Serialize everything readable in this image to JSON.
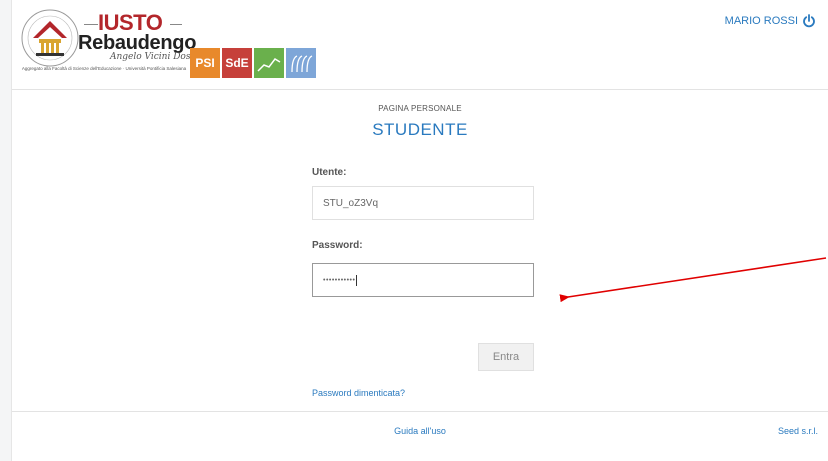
{
  "header": {
    "logo": {
      "brand_top": "IUSTO",
      "brand_name": "Rebaudengo",
      "signature": "Angelo Vicini Dosi",
      "aggregation": "Aggregato alla Facoltà di Scienze dell'Educazione · Università Pontificia Salesiana",
      "tiles": [
        {
          "label": "PSI",
          "color": "#e8892b"
        },
        {
          "label": "SdE",
          "color": "#c6403a"
        },
        {
          "label": "",
          "color": "#6ab04c"
        },
        {
          "label": "",
          "color": "#7ea6d8"
        }
      ]
    },
    "user": {
      "name": "MARIO ROSSI",
      "logout_icon": "power-icon"
    }
  },
  "main": {
    "subtitle": "PAGINA PERSONALE",
    "title": "STUDENTE",
    "username_label": "Utente:",
    "username_value": "STU_oZ3Vq",
    "password_label": "Password:",
    "password_value": "•••••••••••",
    "submit_label": "Entra",
    "forgot_label": "Password dimenticata?"
  },
  "footer": {
    "guide_label": "Guida all'uso",
    "vendor_label": "Seed s.r.l."
  },
  "colors": {
    "accent": "#2a7abf",
    "brand_red": "#b3262b",
    "annotation_arrow": "#e00000"
  }
}
